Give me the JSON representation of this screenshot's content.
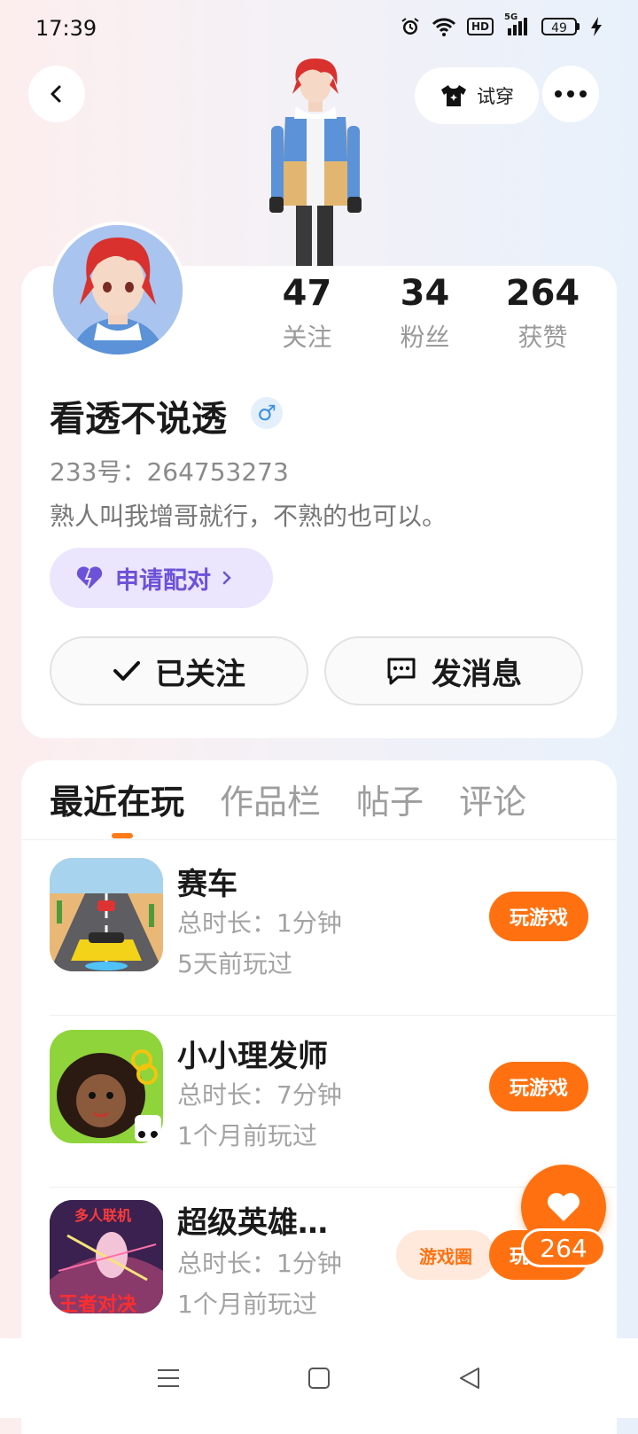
{
  "status_bar": {
    "time": "17:39",
    "hd": "HD",
    "network": "5G",
    "battery": "49"
  },
  "header": {
    "tryon_label": "试穿"
  },
  "profile": {
    "stats": [
      {
        "value": "47",
        "label": "关注"
      },
      {
        "value": "34",
        "label": "粉丝"
      },
      {
        "value": "264",
        "label": "获赞"
      }
    ],
    "username": "看透不说透",
    "gender_symbol": "♂",
    "uid": "233号：264753273",
    "bio": "熟人叫我增哥就行，不熟的也可以。",
    "pair_label": "申请配对",
    "follow_label": "已关注",
    "message_label": "发消息"
  },
  "tabs": [
    "最近在玩",
    "作品栏",
    "帖子",
    "评论"
  ],
  "games": [
    {
      "name": "赛车",
      "duration": "总时长：1分钟",
      "last_played": "5天前玩过",
      "play_label": "玩游戏",
      "icon": "racing-game-icon"
    },
    {
      "name": "小小理发师",
      "duration": "总时长：7分钟",
      "last_played": "1个月前玩过",
      "play_label": "玩游戏",
      "icon": "barber-game-icon"
    },
    {
      "name": "超级英雄…",
      "duration": "总时长：1分钟",
      "last_played": "1个月前玩过",
      "play_label": "玩游戏",
      "circle_label": "游戏圈",
      "icon": "hero-game-icon",
      "icon_text_top": "多人联机",
      "icon_text_bottom": "王者对决"
    }
  ],
  "like": {
    "count": "264"
  },
  "colors": {
    "accent": "#ff7110",
    "pair": "#6b52d8",
    "gender": "#3d8fe0"
  }
}
